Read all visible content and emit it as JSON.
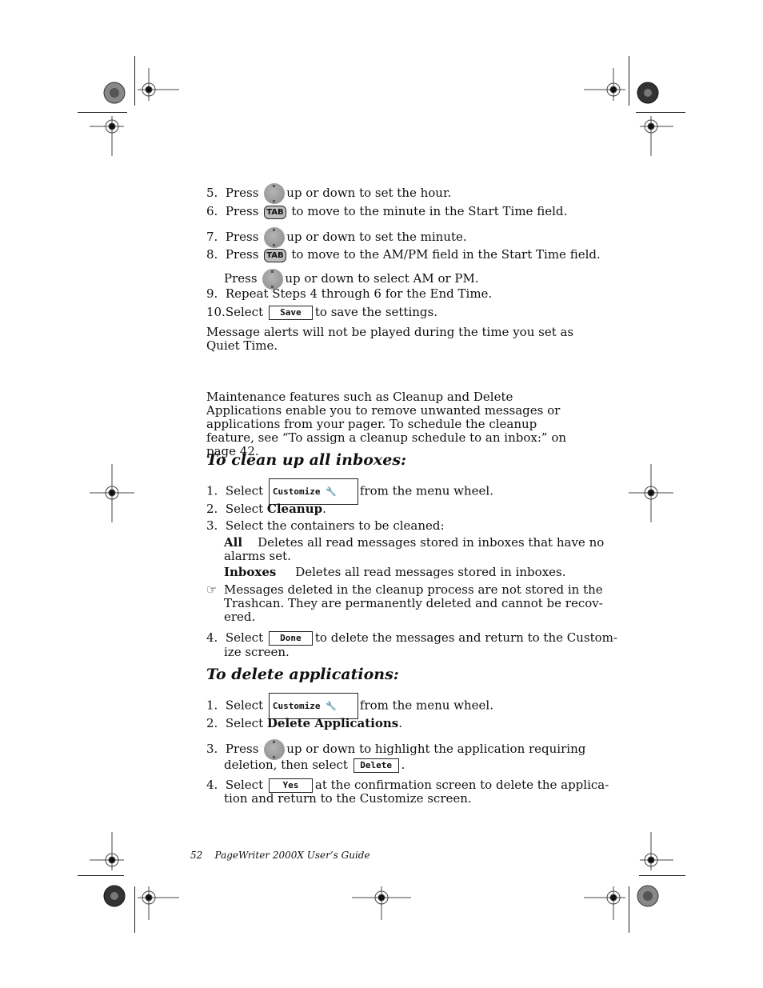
{
  "steps_top": [
    {
      "num": "5.",
      "pre": "Press",
      "icon": "nav",
      "post": "up or down to set the hour."
    },
    {
      "num": "6.",
      "pre": "Press",
      "icon": "tab",
      "post": "to move to the minute in the Start Time field."
    },
    {
      "num": "7.",
      "pre": "Press",
      "icon": "nav",
      "post": "up or down to set the minute."
    },
    {
      "num": "8.",
      "pre": "Press",
      "icon": "tab",
      "post": "to move to the AM/PM field in the Start Time field."
    },
    {
      "num": "",
      "pre": "Press",
      "icon": "nav",
      "post": "up or down to select AM or PM."
    },
    {
      "num": "9.",
      "pre": "",
      "icon": "",
      "post": "Repeat Steps 4 through 6 for the End Time."
    },
    {
      "num": "10.",
      "pre": "Select",
      "icon": "save",
      "post": "to save the settings."
    }
  ],
  "keys": {
    "tab": "TAB",
    "save": "Save",
    "done": "Done",
    "delete": "Delete",
    "yes": "Yes",
    "customize": "Customize"
  },
  "quiet_note": "Message alerts will not be played during the time you set as Quiet Time.",
  "maintenance_intro": "Maintenance features such as Cleanup and Delete Applications enable you to remove unwanted messages or applications from your pager. To schedule the cleanup feature, see “To assign a cleanup schedule to an inbox:” on page 42.",
  "cleanup": {
    "heading": "To clean up all inboxes:",
    "s1_num": "1.",
    "s1_pre": "Select",
    "s1_post": "from the menu wheel.",
    "s2_num": "2.",
    "s2_pre": "Select",
    "s2_bold": "Cleanup",
    "s2_post": ".",
    "s3_num": "3.",
    "s3_text": "Select the containers to be cleaned:",
    "opt_all_label": "All",
    "opt_all_desc": "Deletes all read messages stored in inboxes that have no",
    "opt_all_desc2": "alarms set.",
    "opt_inbox_label": "Inboxes",
    "opt_inbox_desc": "Deletes all read messages stored in inboxes.",
    "note_l1": "Messages deleted in the cleanup process are not stored in the",
    "note_l2": "Trashcan. They are permanently deleted and cannot be recov-",
    "note_l3": "ered.",
    "s4_num": "4.",
    "s4_pre": "Select",
    "s4_post": "to delete the messages and return to the Custom-",
    "s4_post2": "ize screen."
  },
  "delete_apps": {
    "heading": "To delete applications:",
    "s1_num": "1.",
    "s1_pre": "Select",
    "s1_post": "from the menu wheel.",
    "s2_num": "2.",
    "s2_pre": "Select",
    "s2_bold": "Delete Applications",
    "s2_post": ".",
    "s3_num": "3.",
    "s3_pre": "Press",
    "s3_post": "up or down to highlight the application requiring",
    "s3_l2_pre": "deletion, then select",
    "s3_l2_post": ".",
    "s4_num": "4.",
    "s4_pre": "Select",
    "s4_post": "at the confirmation screen to delete the applica-",
    "s4_post2": "tion and return to the Customize screen."
  },
  "footer": {
    "page": "52",
    "title": "PageWriter 2000X User’s Guide"
  }
}
